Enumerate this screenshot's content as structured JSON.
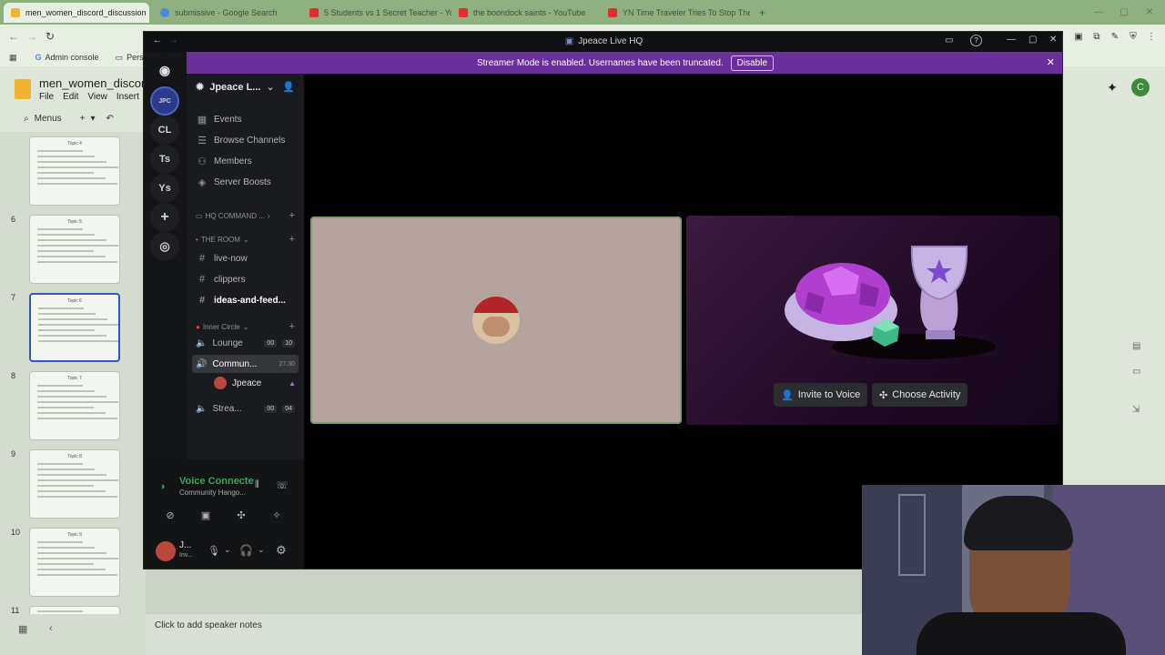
{
  "browser": {
    "tabs": [
      {
        "title": "men_women_discord_discussion",
        "color": "#f2b233",
        "active": true
      },
      {
        "title": "submissive - Google Search",
        "color": "#4a89dc",
        "active": false
      },
      {
        "title": "5 Students vs 1 Secret Teacher - YouTub",
        "color": "#e02e2e",
        "active": false
      },
      {
        "title": "the boondock saints - YouTube",
        "color": "#e02e2e",
        "active": false
      },
      {
        "title": "YN Time Traveler Tries To Stop The Te",
        "color": "#e02e2e",
        "active": false
      }
    ],
    "new_tab": "+",
    "bookmarks": [
      "Admin console",
      "Person"
    ]
  },
  "slides": {
    "doc_title": "men_women_discord",
    "menu": [
      "File",
      "Edit",
      "View",
      "Insert"
    ],
    "menus_label": "Menus",
    "avatar_letter": "C",
    "speaker_notes": "Click to add speaker notes",
    "thumbs": [
      {
        "num": "",
        "title": "Topic 4"
      },
      {
        "num": "6",
        "title": "Topic 5"
      },
      {
        "num": "7",
        "title": "Topic 6",
        "selected": true
      },
      {
        "num": "8",
        "title": "Topic 7"
      },
      {
        "num": "9",
        "title": "Topic 8"
      },
      {
        "num": "10",
        "title": "Topic 9"
      },
      {
        "num": "11",
        "title": ""
      }
    ]
  },
  "discord": {
    "window_title": "Jpeace Live HQ",
    "banner_text": "Streamer Mode is enabled. Usernames have been truncated.",
    "banner_button": "Disable",
    "rail": [
      "CL",
      "Ts",
      "Ys"
    ],
    "server_name": "Jpeace L...",
    "nav": [
      {
        "icon": "calendar-icon",
        "glyph": "▦",
        "label": "Events"
      },
      {
        "icon": "browse-channels-icon",
        "glyph": "☰",
        "label": "Browse Channels"
      },
      {
        "icon": "members-icon",
        "glyph": "👥",
        "label": "Members"
      },
      {
        "icon": "server-boost-icon",
        "glyph": "◈",
        "label": "Server Boosts"
      }
    ],
    "categories": {
      "hq": "HQ COMMAND ...",
      "room": "THE ROOM",
      "inner": "Inner Circle"
    },
    "text_channels": [
      "live-now",
      "clippers",
      "ideas-and-feed..."
    ],
    "voice_channels": [
      {
        "name": "Lounge",
        "a": "00",
        "b": "10"
      },
      {
        "name": "Commun...",
        "time": "27:30"
      },
      {
        "name": "Strea...",
        "a": "00",
        "b": "04"
      }
    ],
    "voice_user": "Jpeace",
    "voice_status": "Voice Connecte",
    "voice_channel": "Community Hango...",
    "user_name": "J...",
    "user_status": "Inv...",
    "invite_label": "Invite to Voice",
    "activity_label": "Choose Activity"
  },
  "colors": {
    "banner": "#6a2f9a",
    "voice_green": "#3ba55d",
    "tab_bar": "#8fb07f"
  }
}
